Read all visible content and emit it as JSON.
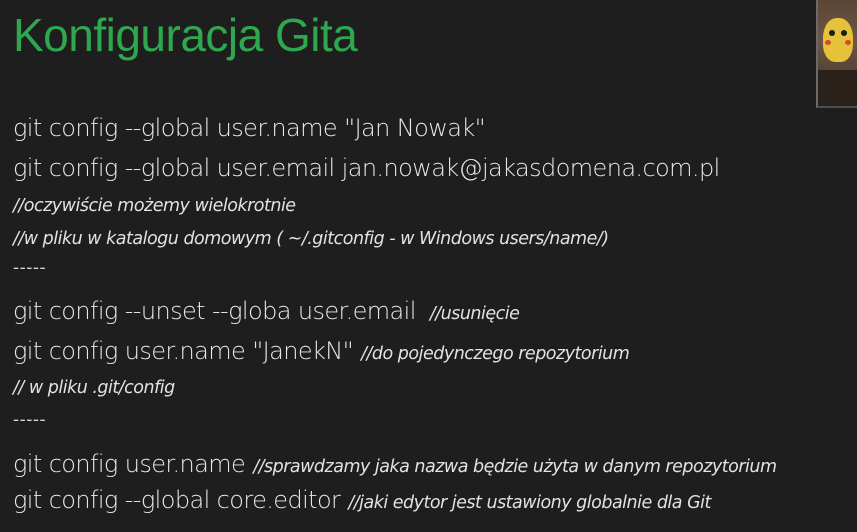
{
  "slide": {
    "title": "Konfiguracja Gita",
    "lines": [
      {
        "cmd": "git config --global user.name \"Jan Nowak\"",
        "comment": ""
      },
      {
        "cmd": "git config --global user.email jan.nowak@jakasdomena.com.pl",
        "comment": ""
      },
      {
        "cmd": "",
        "comment": "//oczywiście możemy wielokrotnie"
      },
      {
        "cmd": "",
        "comment": "//w pliku w katalogu domowym ( ~/.gitconfig - w Windows users/name/)"
      },
      {
        "sep": "-----"
      },
      {
        "cmd": "git config --unset --globa user.email",
        "comment": "//usunięcie"
      },
      {
        "cmd": "git config user.name \"JanekN\"",
        "comment": "//do pojedynczego repozytorium"
      },
      {
        "cmd": "",
        "comment": "// w pliku .git/config"
      },
      {
        "sep": "-----"
      },
      {
        "cmd": "git config user.name",
        "comment": "//sprawdzamy jaka nazwa będzie użyta w danym repozytorium"
      },
      {
        "cmd": "git config --global core.editor",
        "comment": "//jaki edytor jest ustawiony globalnie dla Git"
      }
    ]
  },
  "colors": {
    "background": "#1e1e1e",
    "title": "#2ea84e",
    "text": "#e8e8e8"
  },
  "webcam": {
    "icon": "webcam-video-thumbnail"
  }
}
